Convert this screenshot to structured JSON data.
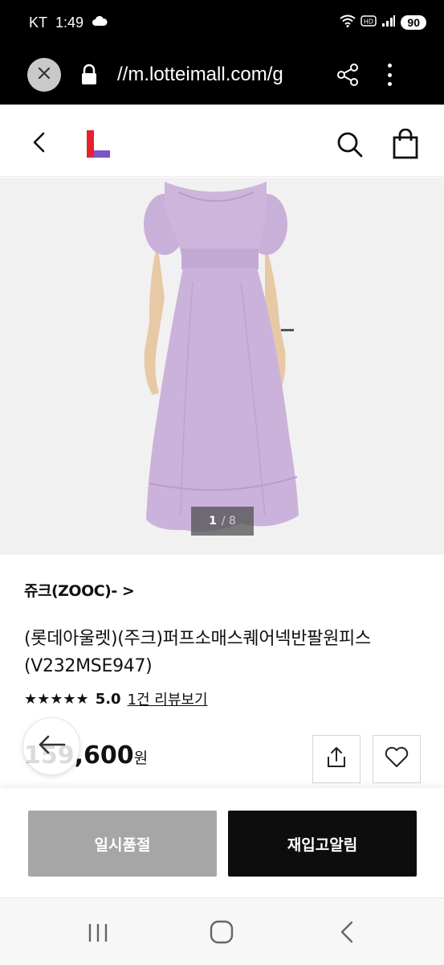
{
  "status_bar": {
    "carrier": "KT",
    "time": "1:49",
    "battery": "90"
  },
  "browser": {
    "url": "//m.lotteimall.com/g"
  },
  "product": {
    "image_counter_current": "1",
    "image_counter_total": "/ 8",
    "brand": "쥬크(ZOOC)- >",
    "title": "(롯데아울렛)(주크)퍼프소매스퀘어넥반팔원피스(V232MSE947)",
    "stars": "★★★★★",
    "rating_score": "5.0",
    "review_link": "1건 리뷰보기",
    "price": "159,600",
    "price_unit": "원"
  },
  "actions": {
    "soldout_label": "일시품절",
    "restock_label": "재입고알림"
  },
  "colors": {
    "dress": "#c8b0d8",
    "logo_red": "#e5212d",
    "logo_purple": "#7b55c9"
  },
  "icons": [
    "close-icon",
    "lock-icon",
    "share-icon",
    "more-vertical-icon",
    "chevron-left-icon",
    "search-icon",
    "shopping-bag-icon",
    "arrow-left-icon",
    "heart-icon",
    "recents-icon",
    "home-icon",
    "back-icon"
  ]
}
